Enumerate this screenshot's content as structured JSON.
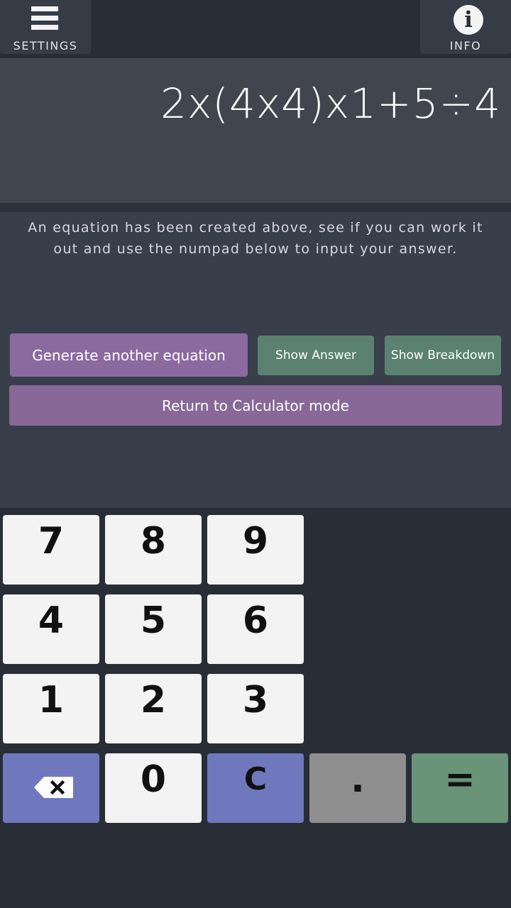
{
  "header": {
    "settings_label": "SETTINGS",
    "info_label": "INFO",
    "settings_icon": "hamburger-menu-icon",
    "info_icon": "info-icon"
  },
  "display": {
    "equation": "2x(4x4)x1+5÷4"
  },
  "instructions": {
    "text": "An equation has been created above, see if you can work it out and use the numpad below to input your answer."
  },
  "actions": {
    "generate_label": "Generate another equation",
    "show_answer_label": "Show Answer",
    "show_breakdown_label": "Show Breakdown",
    "return_label": "Return to Calculator mode"
  },
  "keypad": {
    "k7": "7",
    "k8": "8",
    "k9": "9",
    "k4": "4",
    "k5": "5",
    "k6": "6",
    "k1": "1",
    "k2": "2",
    "k3": "3",
    "k0": "0",
    "clear": "C",
    "dot": ".",
    "equals": "=",
    "backspace_icon": "backspace-icon"
  },
  "colors": {
    "background": "#292e36",
    "display_bg": "#40454e",
    "purple_button": "#8b6aa0",
    "green_button": "#5b8170",
    "key_blue": "#6f78bd",
    "key_gray": "#8e8e8e",
    "key_green": "#6a9478"
  }
}
